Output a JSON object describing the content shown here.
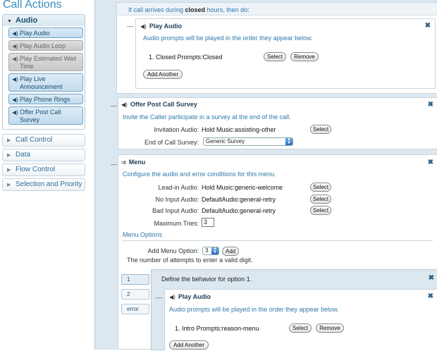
{
  "sidebar": {
    "title": "Call Actions",
    "audio_group": {
      "label": "Audio",
      "items": [
        {
          "label": "Play Audio",
          "disabled": false
        },
        {
          "label": "Play Audio Loop",
          "disabled": true
        },
        {
          "label": "Play Estimated Wait Time",
          "disabled": true
        },
        {
          "label": "Play Live Announcement",
          "disabled": false
        },
        {
          "label": "Play Phone Rings",
          "disabled": false
        },
        {
          "label": "Offer Post Call Survey",
          "disabled": false
        }
      ]
    },
    "groups": [
      "Call Control",
      "Data",
      "Flow Control",
      "Selection and Priority"
    ]
  },
  "closed_hours": {
    "prefix": "If call arrives during",
    "bold": "closed",
    "suffix": "hours, then do:"
  },
  "play_audio_1": {
    "title": "Play Audio",
    "desc": "Audio prompts will be played in the order they appear below.",
    "item": "1.  Closed Prompts:Closed",
    "select_label": "Select",
    "remove_label": "Remove",
    "add_another": "Add Another"
  },
  "survey": {
    "title": "Offer Post Call Survey",
    "desc": "Invite the Caller participate in a survey at the end of the call.",
    "invitation_label": "Invitation Audio:",
    "invitation_value": "Hold Music:assisting-other",
    "select_label": "Select",
    "end_label": "End of Call Survey:",
    "end_value": "Generic Survey"
  },
  "menu": {
    "title": "Menu",
    "desc": "Configure the audio and error conditions for this menu.",
    "leadin_label": "Lead-in Audio:",
    "leadin_value": "Hold Music:generic-welcome",
    "noinput_label": "No Input Audio:",
    "noinput_value": "DefaultAudio:general-retry",
    "badinput_label": "Bad Input Audio:",
    "badinput_value": "DefaultAudio:general-retry",
    "select_label": "Select",
    "max_tries_label": "Maximum Tries:",
    "max_tries_value": "3",
    "options_link": "Menu Options",
    "add_option_label": "Add Menu Option:",
    "add_option_value": "3",
    "add_label": "Add",
    "attempts_note": "The number of attempts to enter a valid digit.",
    "option_tabs": [
      "1",
      "2",
      "error"
    ],
    "option_header": "Define the behavior for option 1."
  },
  "play_audio_2": {
    "title": "Play Audio",
    "desc": "Audio prompts will be played in the order they appear below.",
    "item": "1.  Intro Prompts:reason-menu",
    "select_label": "Select",
    "remove_label": "Remove",
    "add_another": "Add Another"
  },
  "icons": {
    "close": "x-icon",
    "speaker": "speaker-icon",
    "menu": "menu-icon",
    "collapse": "dash-icon"
  },
  "colors": {
    "accent": "#3a8ec2",
    "link_text": "#2e79ad",
    "action_fill": "#c4dcee",
    "canvas": "#dce7ef"
  }
}
